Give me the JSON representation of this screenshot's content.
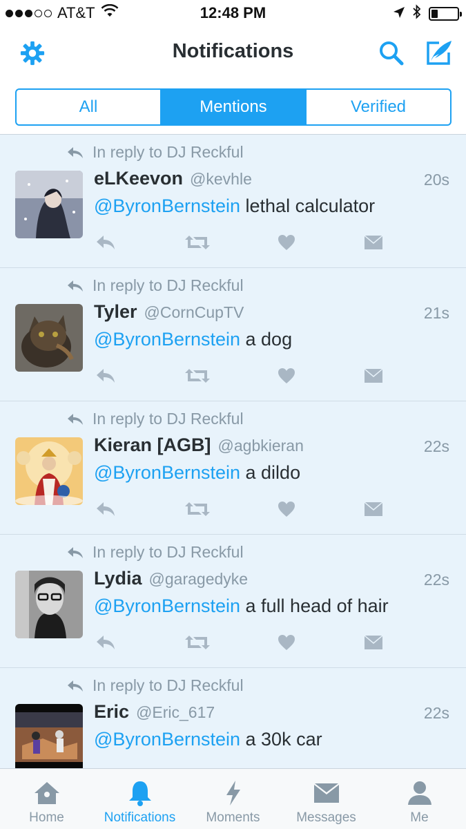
{
  "status_bar": {
    "carrier": "AT&T",
    "time": "12:48 PM"
  },
  "nav": {
    "title": "Notifications"
  },
  "filter_tabs": [
    {
      "label": "All",
      "active": false
    },
    {
      "label": "Mentions",
      "active": true
    },
    {
      "label": "Verified",
      "active": false
    }
  ],
  "tweets": [
    {
      "reply_context": "In reply to DJ Reckful",
      "name": "eLKeevon",
      "handle": "@kevhle",
      "time": "20s",
      "mention": "@ByronBernstein",
      "text": " lethal calculator"
    },
    {
      "reply_context": "In reply to DJ Reckful",
      "name": "Tyler",
      "handle": "@CornCupTV",
      "time": "21s",
      "mention": "@ByronBernstein",
      "text": " a dog"
    },
    {
      "reply_context": "In reply to DJ Reckful",
      "name": "Kieran [AGB]",
      "handle": "@agbkieran",
      "time": "22s",
      "mention": "@ByronBernstein",
      "text": " a dildo"
    },
    {
      "reply_context": "In reply to DJ Reckful",
      "name": "Lydia",
      "handle": "@garagedyke",
      "time": "22s",
      "mention": "@ByronBernstein",
      "text": " a full head of hair"
    },
    {
      "reply_context": "In reply to DJ Reckful",
      "name": "Eric",
      "handle": "@Eric_617",
      "time": "22s",
      "mention": "@ByronBernstein",
      "text": " a 30k car"
    }
  ],
  "tab_bar": [
    {
      "label": "Home",
      "icon": "home-icon",
      "active": false
    },
    {
      "label": "Notifications",
      "icon": "bell-icon",
      "active": true
    },
    {
      "label": "Moments",
      "icon": "lightning-icon",
      "active": false
    },
    {
      "label": "Messages",
      "icon": "envelope-icon",
      "active": false
    },
    {
      "label": "Me",
      "icon": "person-icon",
      "active": false
    }
  ],
  "colors": {
    "accent": "#1da1f2",
    "tweet_background": "#e8f3fb",
    "secondary_text": "#8899a6",
    "primary_text": "#292f33"
  }
}
